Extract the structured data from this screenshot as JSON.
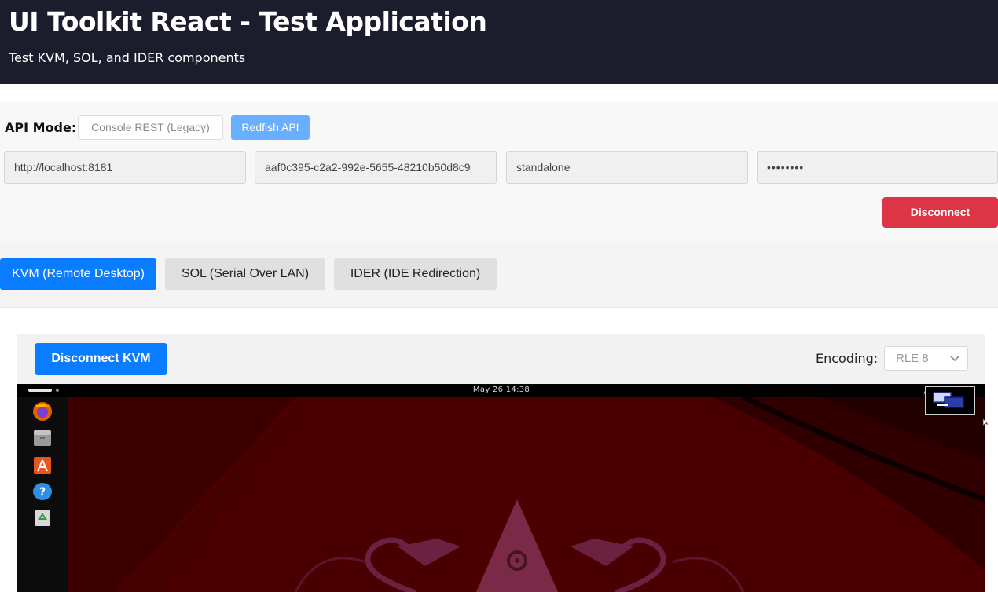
{
  "header": {
    "title": "UI Toolkit React - Test Application",
    "subtitle": "Test KVM, SOL, and IDER components"
  },
  "connection": {
    "api_mode_label": "API Mode:",
    "modes": [
      {
        "label": "Console REST (Legacy)",
        "selected": false
      },
      {
        "label": "Redfish API",
        "selected": true
      }
    ],
    "fields": {
      "url": "http://localhost:8181",
      "device_guid": "aaf0c395-c2a2-992e-5655-48210b50d8c9",
      "mode": "standalone",
      "password": "••••••••"
    },
    "disconnect_label": "Disconnect",
    "disconnect_color": "#dc3545"
  },
  "tabs": [
    {
      "label": "KVM (Remote Desktop)",
      "active": true
    },
    {
      "label": "SOL (Serial Over LAN)",
      "active": false
    },
    {
      "label": "IDER (IDE Redirection)",
      "active": false
    }
  ],
  "kvm": {
    "disconnect_label": "Disconnect KVM",
    "encoding_label": "Encoding:",
    "encoding_value": "RLE 8",
    "accent_color": "#0a7cff",
    "remote_screen": {
      "clock": "May 26  14:38",
      "dock_icons": [
        "firefox-icon",
        "files-icon",
        "app-center-icon",
        "help-icon",
        "trash-icon"
      ],
      "tray_icons": [
        "network-icon",
        "volume-icon",
        "power-icon"
      ],
      "wallpaper_color": "#4a0000"
    }
  }
}
